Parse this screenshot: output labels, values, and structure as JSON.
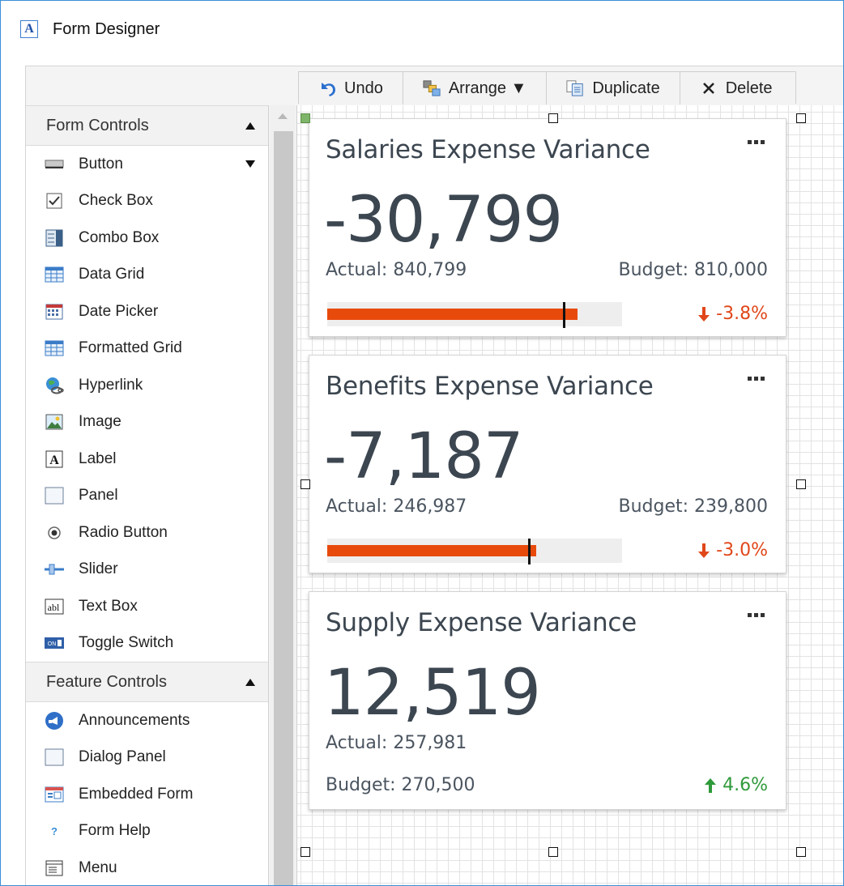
{
  "window": {
    "title": "Form Designer",
    "icon": "A"
  },
  "toolbar": {
    "undo": "Undo",
    "arrange": "Arrange ▼",
    "duplicate": "Duplicate",
    "delete": "Delete"
  },
  "form_controls": {
    "header": "Form Controls",
    "items": [
      {
        "label": "Button",
        "icon": "button-icon"
      },
      {
        "label": "Check Box",
        "icon": "checkbox-icon"
      },
      {
        "label": "Combo Box",
        "icon": "combobox-icon"
      },
      {
        "label": "Data Grid",
        "icon": "data-grid-icon"
      },
      {
        "label": "Date Picker",
        "icon": "calendar-icon"
      },
      {
        "label": "Formatted Grid",
        "icon": "formatted-grid-icon"
      },
      {
        "label": "Hyperlink",
        "icon": "hyperlink-icon"
      },
      {
        "label": "Image",
        "icon": "image-icon"
      },
      {
        "label": "Label",
        "icon": "label-icon"
      },
      {
        "label": "Panel",
        "icon": "panel-icon"
      },
      {
        "label": "Radio Button",
        "icon": "radio-icon"
      },
      {
        "label": "Slider",
        "icon": "slider-icon"
      },
      {
        "label": "Text Box",
        "icon": "textbox-icon"
      },
      {
        "label": "Toggle Switch",
        "icon": "toggle-icon"
      }
    ]
  },
  "feature_controls": {
    "header": "Feature Controls",
    "items": [
      {
        "label": "Announcements",
        "icon": "announcements-icon"
      },
      {
        "label": "Dialog Panel",
        "icon": "dialog-panel-icon"
      },
      {
        "label": "Embedded Form",
        "icon": "embedded-form-icon"
      },
      {
        "label": "Form Help",
        "icon": "help-icon"
      },
      {
        "label": "Menu",
        "icon": "menu-icon"
      }
    ]
  },
  "cards": [
    {
      "title": "Salaries Expense Variance",
      "value": "-30,799",
      "actual": "Actual: 840,799",
      "budget": "Budget: 810,000",
      "variance": "-3.8%",
      "direction": "down",
      "bar_fill_fraction": 0.85,
      "bar_target_fraction": 0.8
    },
    {
      "title": "Benefits Expense Variance",
      "value": "-7,187",
      "actual": "Actual: 246,987",
      "budget": "Budget: 239,800",
      "variance": "-3.0%",
      "direction": "down",
      "bar_fill_fraction": 0.71,
      "bar_target_fraction": 0.68
    },
    {
      "title": "Supply Expense Variance",
      "value": "12,519",
      "actual": "Actual: 257,981",
      "budget": "Budget: 270,500",
      "variance": "4.6%",
      "direction": "up"
    }
  ],
  "colors": {
    "down": "#e0471a",
    "up": "#2f9a3a",
    "bar": "#e84a0c"
  }
}
